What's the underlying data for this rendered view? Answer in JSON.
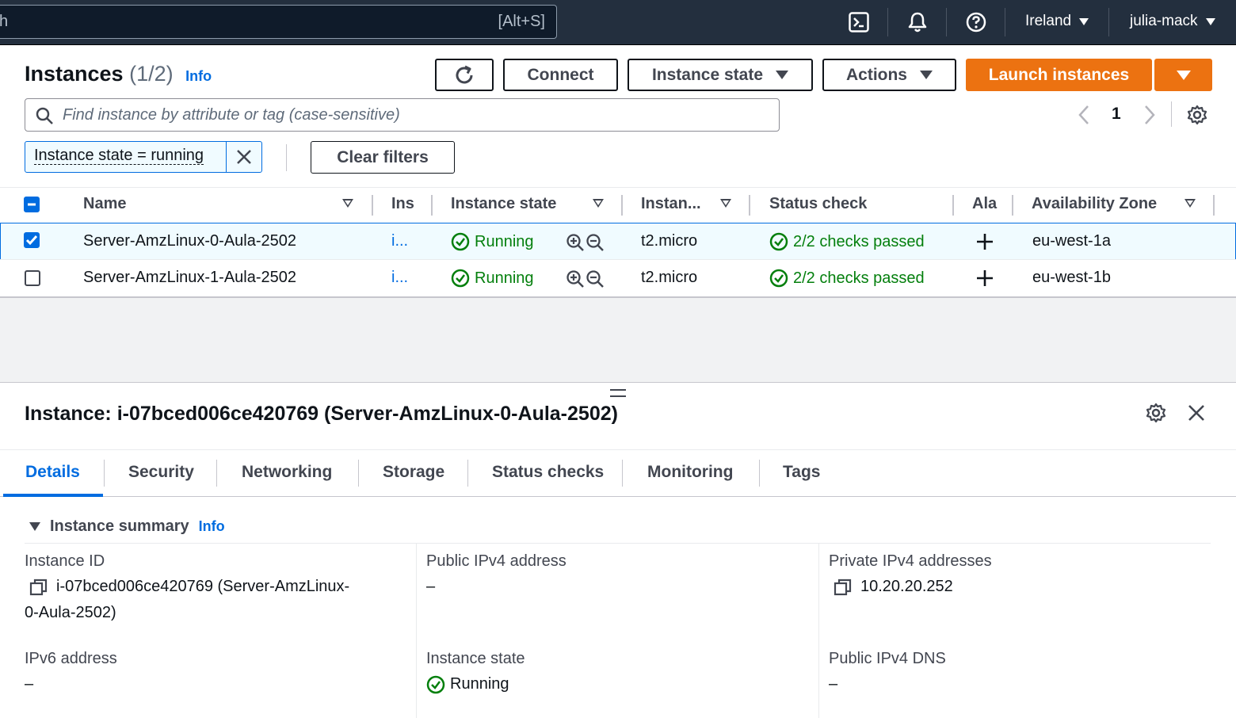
{
  "topbar": {
    "search_placeholder": "h",
    "search_shortcut": "[Alt+S]",
    "region": "Ireland",
    "user": "julia-mack",
    "icons": [
      "cloudshell-icon",
      "bell-icon",
      "help-icon"
    ]
  },
  "instances": {
    "title": "Instances",
    "count": "(1/2)",
    "info": "Info",
    "buttons": {
      "connect": "Connect",
      "instance_state": "Instance state",
      "actions": "Actions",
      "launch": "Launch instances"
    },
    "search_placeholder": "Find instance by attribute or tag (case-sensitive)",
    "page": "1",
    "filter_token": "Instance state = running",
    "clear_filters": "Clear filters",
    "columns": [
      "Name",
      "Ins",
      "Instance state",
      "Instan...",
      "Status check",
      "Ala",
      "Availability Zone"
    ],
    "rows": [
      {
        "name": "Server-AmzLinux-0-Aula-2502",
        "id": "i...",
        "state": "Running",
        "type": "t2.micro",
        "status": "2/2 checks passed",
        "alarm": "+",
        "az": "eu-west-1a",
        "selected": true
      },
      {
        "name": "Server-AmzLinux-1-Aula-2502",
        "id": "i...",
        "state": "Running",
        "type": "t2.micro",
        "status": "2/2 checks passed",
        "alarm": "+",
        "az": "eu-west-1b",
        "selected": false
      }
    ]
  },
  "details": {
    "title": "Instance: i-07bced006ce420769 (Server-AmzLinux-0-Aula-2502)",
    "tabs": [
      "Details",
      "Security",
      "Networking",
      "Storage",
      "Status checks",
      "Monitoring",
      "Tags"
    ],
    "summary_label": "Instance summary",
    "summary_info": "Info",
    "fields": {
      "instance_id_label": "Instance ID",
      "instance_id_value_1": "i-07bced006ce420769 (Server-AmzLinux-",
      "instance_id_value_2": "0-Aula-2502)",
      "public_ipv4_label": "Public IPv4 address",
      "public_ipv4_value": "–",
      "private_ipv4_label": "Private IPv4 addresses",
      "private_ipv4_value": "10.20.20.252",
      "ipv6_label": "IPv6 address",
      "ipv6_value": "–",
      "state_label": "Instance state",
      "state_value": "Running",
      "public_dns_label": "Public IPv4 DNS",
      "public_dns_value": "–"
    }
  },
  "colors": {
    "accent": "#006ce0",
    "launch_orange": "#ec7211",
    "success_green": "#037f0c",
    "topbar": "#232f3e"
  }
}
